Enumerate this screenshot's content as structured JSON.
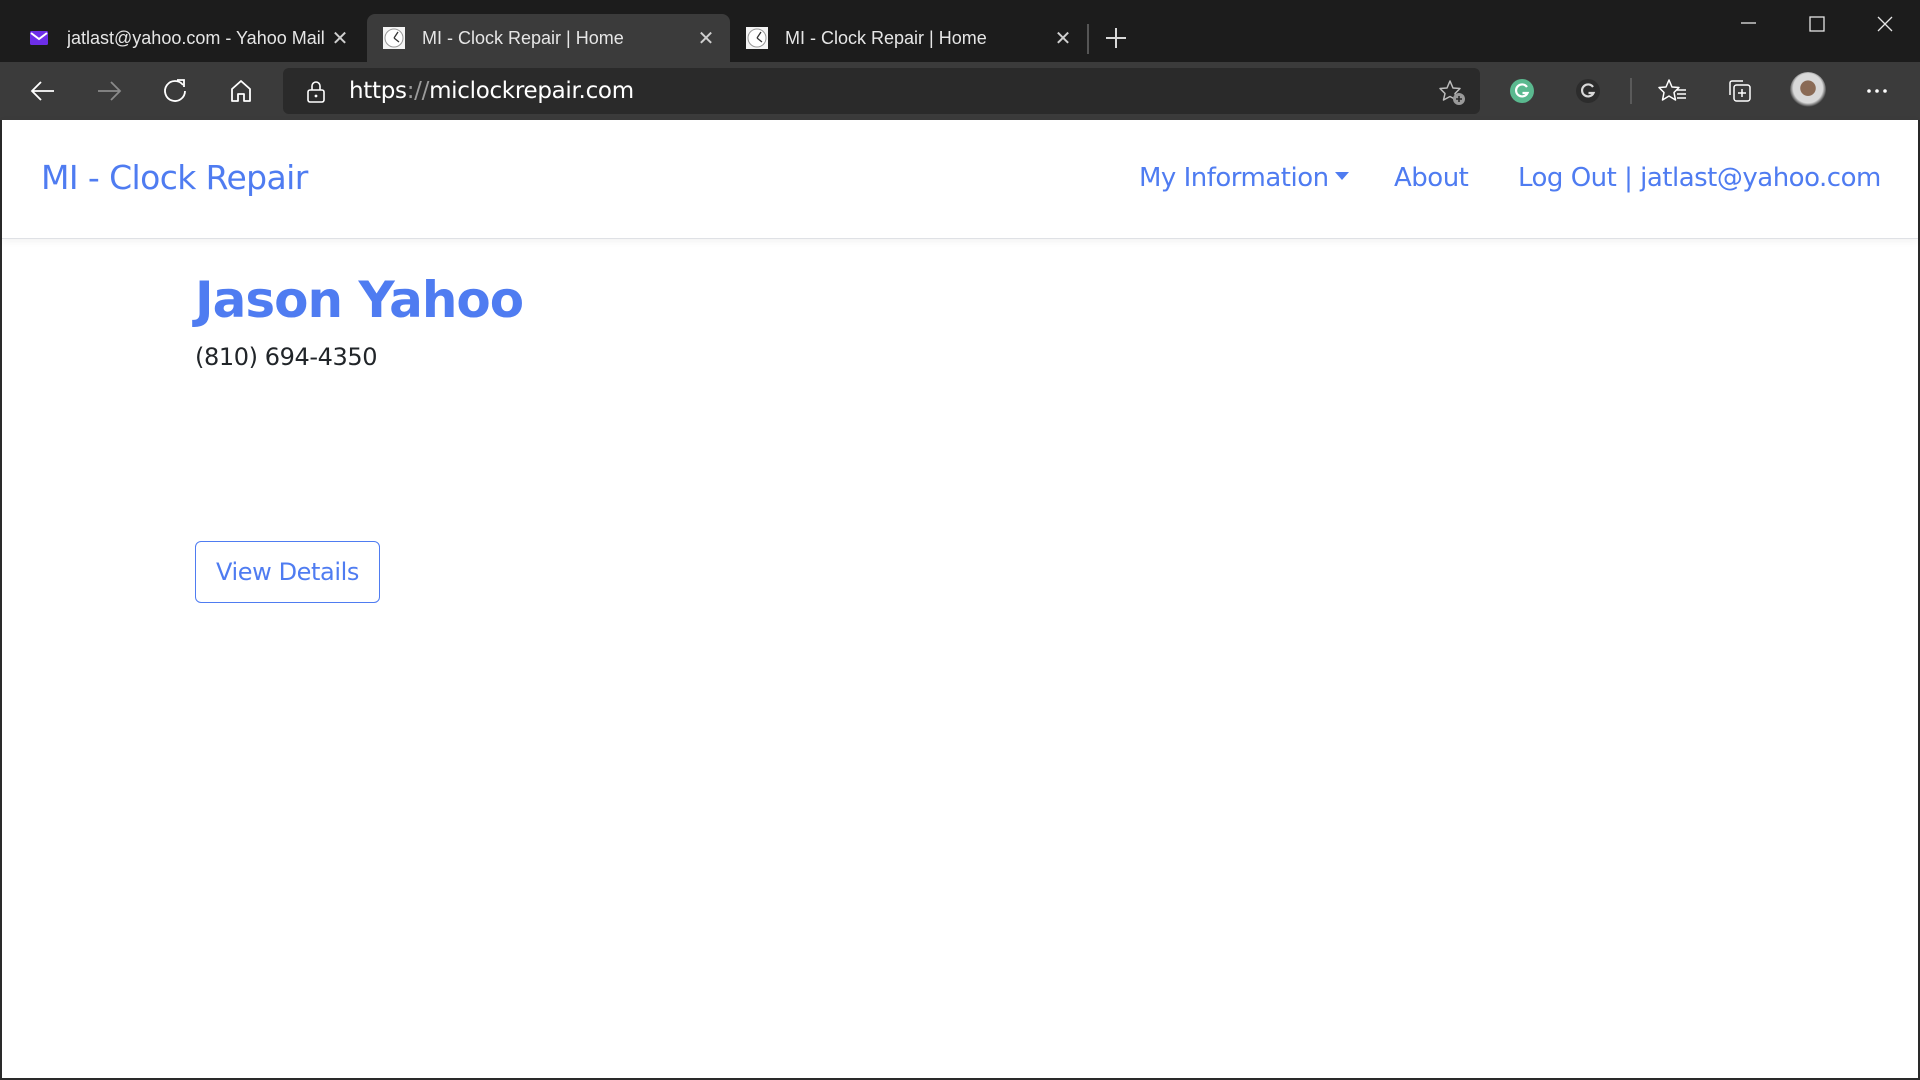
{
  "browser": {
    "tabs": [
      {
        "title": "jatlast@yahoo.com - Yahoo Mail",
        "icon": "yahoo-mail-icon",
        "active": false
      },
      {
        "title": "MI - Clock Repair | Home",
        "icon": "clock-favicon",
        "active": true
      },
      {
        "title": "MI - Clock Repair | Home",
        "icon": "clock-favicon",
        "active": false
      }
    ],
    "address": {
      "scheme": "https",
      "separator": "://",
      "host": "miclockrepair.com"
    },
    "colors": {
      "tabstrip_bg": "#1c1c1c",
      "toolbar_bg": "#3b3b3b",
      "address_bg": "#2a2a2a",
      "grammarly_green": "#5ab98f"
    }
  },
  "page": {
    "navbar": {
      "brand": "MI - Clock Repair",
      "links": {
        "my_information": "My Information",
        "about": "About",
        "logout": "Log Out | jatlast@yahoo.com"
      }
    },
    "profile": {
      "name": "Jason Yahoo",
      "phone": "(810) 694-4350",
      "view_details_label": "View Details"
    },
    "colors": {
      "accent": "#4f7cf1",
      "text": "#212529"
    }
  }
}
